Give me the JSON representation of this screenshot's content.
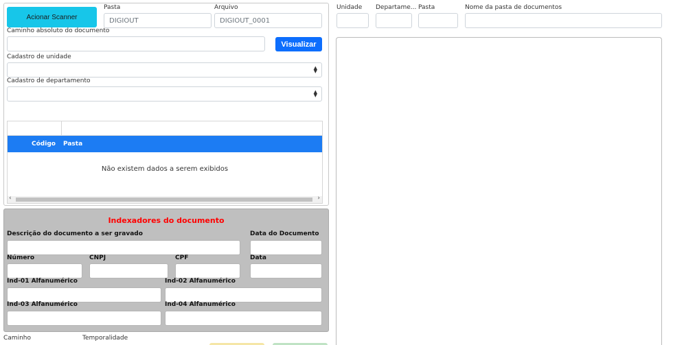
{
  "scanner": {
    "button_label": "Acionar Scanner"
  },
  "pasta": {
    "label": "Pasta",
    "value": "DIGIOUT"
  },
  "arquivo": {
    "label": "Arquivo",
    "value": "DIGIOUT_0001"
  },
  "caminho_absoluto": {
    "label": "Caminho absoluto do documento",
    "value": ""
  },
  "visualizar": {
    "label": "Visualizar"
  },
  "cadastro_unidade": {
    "label": "Cadastro de unidade",
    "value": ""
  },
  "cadastro_departamento": {
    "label": "Cadastro de departamento",
    "value": ""
  },
  "grid": {
    "columns": [
      "Código",
      "Pasta"
    ],
    "empty_message": "Não existem dados a serem exibidos"
  },
  "indexadores": {
    "title": "Indexadores do documento",
    "fields": {
      "descricao": "Descrição do documento a ser gravado",
      "data_documento": "Data do Documento",
      "numero": "Número",
      "cnpj": "CNPJ",
      "cpf": "CPF",
      "data": "Data",
      "ind01": "Ind-01 Alfanumérico",
      "ind02": "Ind-02 Alfanumérico",
      "ind03": "Ind-03 Alfanumérico",
      "ind04": "Ind-04 Alfanumérico"
    }
  },
  "bottom": {
    "caminho_label": "Caminho",
    "temporalidade_label": "Temporalidade"
  },
  "right_header": {
    "unidade": "Unidade",
    "departamento": "Departame...",
    "pasta": "Pasta",
    "nome_pasta": "Nome da pasta de documentos"
  },
  "colors": {
    "accent": "#0d6efd",
    "scanner": "#17c6e9",
    "grid_header": "#1c7cf3",
    "index_title": "#ff0000",
    "index_bg": "#bfbfbf"
  }
}
